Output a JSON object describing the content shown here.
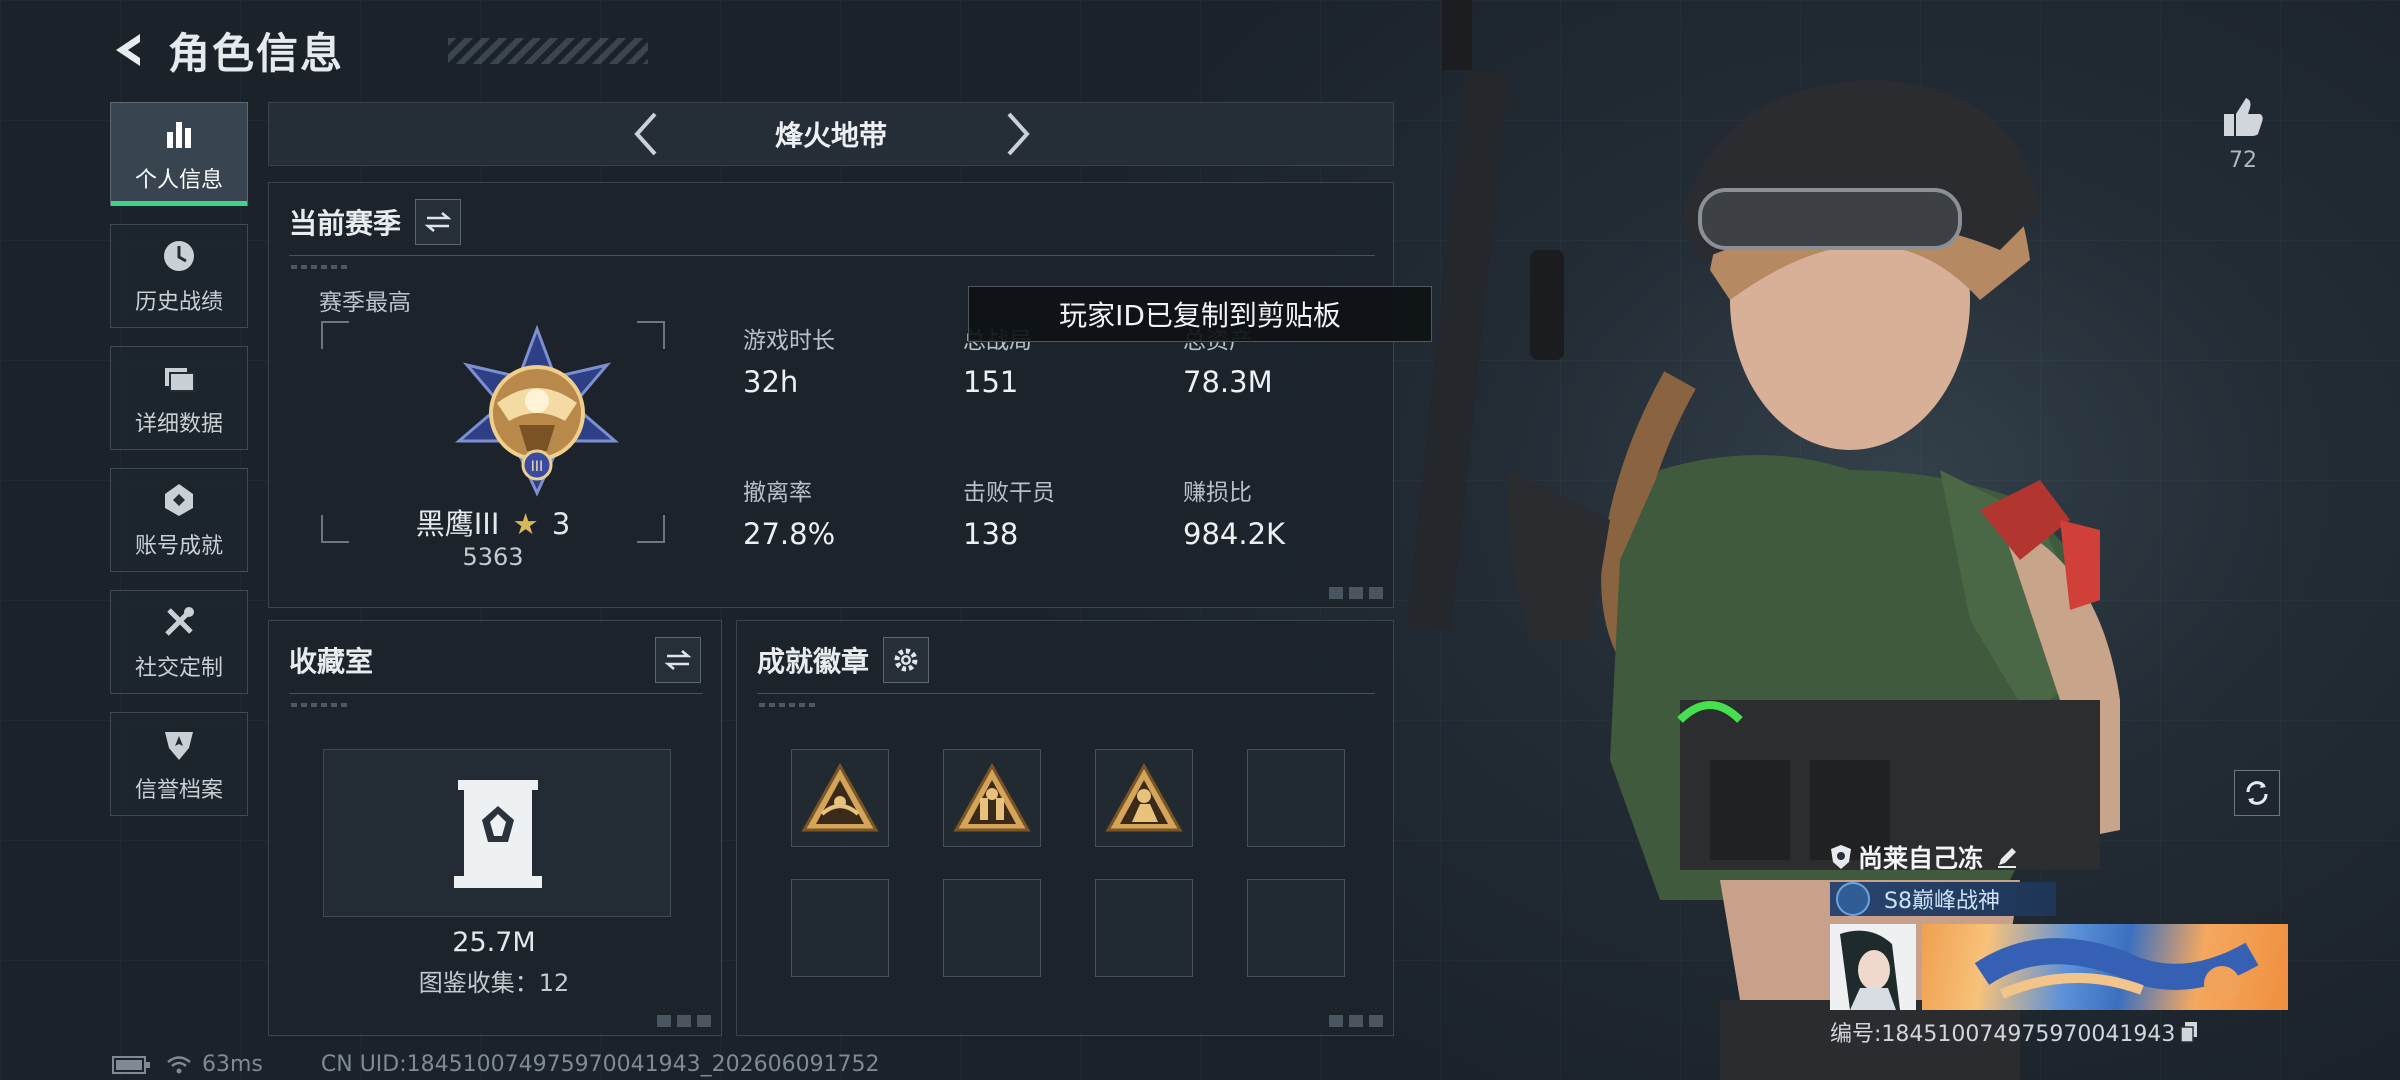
{
  "header": {
    "title": "角色信息"
  },
  "sidebar": {
    "items": [
      {
        "label": "个人信息",
        "icon": "bar-chart-icon",
        "active": true
      },
      {
        "label": "历史战绩",
        "icon": "history-clock-icon",
        "active": false
      },
      {
        "label": "详细数据",
        "icon": "folder-icon",
        "active": false
      },
      {
        "label": "账号成就",
        "icon": "achievement-icon",
        "active": false
      },
      {
        "label": "社交定制",
        "icon": "tools-icon",
        "active": false
      },
      {
        "label": "信誉档案",
        "icon": "shield-badge-icon",
        "active": false
      }
    ]
  },
  "mode": {
    "name": "烽火地带"
  },
  "season": {
    "title": "当前赛季",
    "best_label": "赛季最高",
    "rank_name": "黑鹰III",
    "rank_stars": "3",
    "rank_score": "5363",
    "stats": [
      {
        "label": "游戏时长",
        "value": "32h"
      },
      {
        "label": "总战局",
        "value": "151"
      },
      {
        "label": "总资产",
        "value": "78.3M"
      },
      {
        "label": "撤离率",
        "value": "27.8%"
      },
      {
        "label": "击败干员",
        "value": "138"
      },
      {
        "label": "赚损比",
        "value": "984.2K"
      }
    ]
  },
  "toast": {
    "text": "玩家ID已复制到剪贴板"
  },
  "collection": {
    "title": "收藏室",
    "value": "25.7M",
    "sub": "图鉴收集：12"
  },
  "badges": {
    "title": "成就徽章",
    "filled": 3,
    "slots": 8
  },
  "status": {
    "ping": "63ms",
    "uid": "CN UID:184510074975970041943_202606091752"
  },
  "player": {
    "likes": "72",
    "name": "尚莱自己冻",
    "title": "S8巅峰战神",
    "id_text": "编号:184510074975970041943"
  },
  "colors": {
    "active_accent": "#3fd48a",
    "badge_gold": "#d4a45a"
  }
}
